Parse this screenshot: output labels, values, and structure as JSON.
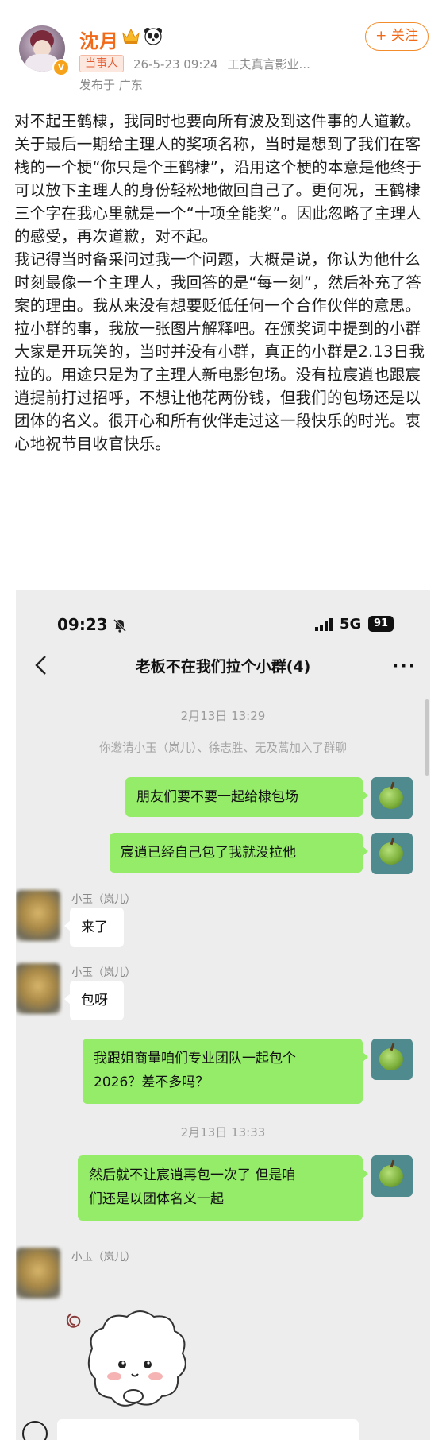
{
  "post": {
    "user_name": "沈月",
    "tag": "当事人",
    "time": "26-5-23 09:24",
    "source": "工夫真言影业...",
    "location": "发布于 广东",
    "follow_label": "+ 关注",
    "paragraphs": [
      "对不起王鹤棣，我同时也要向所有波及到这件事的人道歉。",
      "关于最后一期给主理人的奖项名称，当时是想到了我们在客栈的一个梗“你只是个王鹤棣”，沿用这个梗的本意是他终于可以放下主理人的身份轻松地做回自己了。更何况，王鹤棣三个字在我心里就是一个“十项全能奖”。因此忽略了主理人的感受，再次道歉，对不起。",
      "我记得当时备采问过我一个问题，大概是说，你认为他什么时刻最像一个主理人，我回答的是“每一刻”，然后补充了答案的理由。我从来没有想要贬低任何一个合作伙伴的意思。",
      "拉小群的事，我放一张图片解释吧。在颁奖词中提到的小群大家是开玩笑的，当时并没有小群，真正的小群是2.13日我拉的。用途只是为了主理人新电影包场。没有拉宸逍也跟宸逍提前打过招呼，不想让他花两份钱，但我们的包场还是以团体的名义。很开心和所有伙伴走过这一段快乐的时光。衷心地祝节目收官快乐。"
    ],
    "icons": [
      "crown-icon",
      "panda-icon",
      "verified-badge-icon"
    ]
  },
  "chat": {
    "status_time": "09:23",
    "network": "5G",
    "battery": "91",
    "title": "老板不在我们拉个小群(4)",
    "timestamp_1": "2月13日 13:29",
    "system_message": "你邀请小玉（岚儿）、徐志胜、无及蒿加入了群聊",
    "msg_1": "朋友们要不要一起给棣包场",
    "msg_2": "宸逍已经自己包了我就没拉他",
    "sender_1": "小玉（岚儿）",
    "msg_3": "来了",
    "sender_2": "小玉（岚儿）",
    "msg_4": "包呀",
    "msg_5_line1": "我跟姐商量咱们专业团队一起包个",
    "msg_5_line2": "2026？差不多吗？",
    "timestamp_2": "2月13日 13:33",
    "msg_6_line1": "然后就不让宸逍再包一次了 但是咱",
    "msg_6_line2": "们还是以团体名义一起",
    "sender_3": "小玉（岚儿）",
    "colors": {
      "my_bubble": "#95ec69",
      "their_bubble": "#ffffff",
      "chat_bg": "#ededed",
      "accent": "#f06a1a"
    }
  }
}
